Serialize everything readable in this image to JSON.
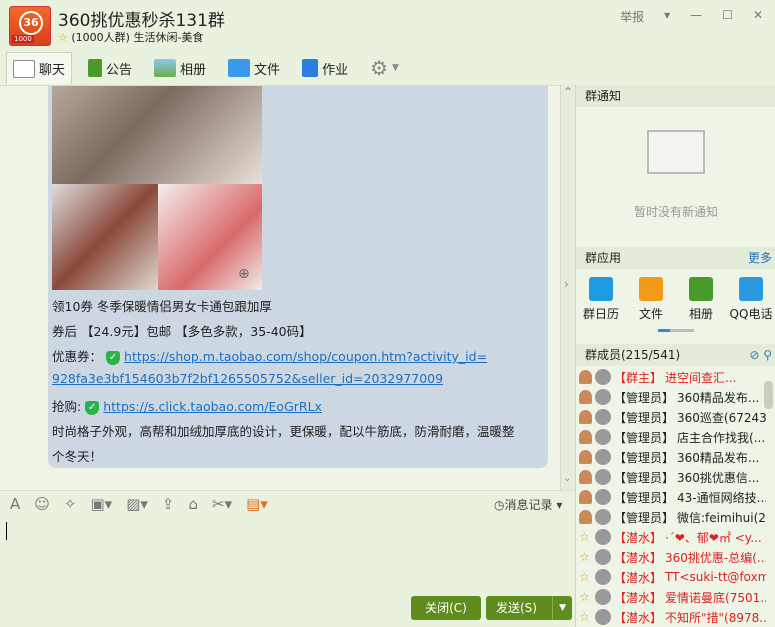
{
  "header": {
    "title": "360挑优惠秒杀131群",
    "subtitle": "(1000人群) 生活休闲-美食",
    "logo_text": "36",
    "logo_badge": "1000",
    "report": "举报",
    "controls": [
      "▾",
      "—",
      "☐",
      "✕"
    ]
  },
  "tabs": [
    {
      "label": "聊天",
      "icon": "chat-icon"
    },
    {
      "label": "公告",
      "icon": "announcement-icon"
    },
    {
      "label": "相册",
      "icon": "album-icon"
    },
    {
      "label": "文件",
      "icon": "folder-icon"
    },
    {
      "label": "作业",
      "icon": "homework-icon"
    }
  ],
  "message": {
    "lines": [
      "领10券 冬季保暖情侣男女卡通包跟加厚",
      "券后 【24.9元】包邮 【多色多款，35-40码】"
    ],
    "coupon_label": "优惠券：",
    "coupon_link_1": "https://shop.m.taobao.com/shop/coupon.htm?activity_id=",
    "coupon_link_2": "928fa3e3bf154603b7f2bf1265505752&seller_id=2032977009",
    "buy_label": "抢购:",
    "buy_link": "https://s.click.taobao.com/EoGrRLx",
    "desc_1": "时尚格子外观，高帮和加绒加厚底的设计，更保暖，配以牛筋底，防滑耐磨，温暖整",
    "desc_2": "个冬天！"
  },
  "notice": {
    "title": "群通知",
    "empty": "暂时没有新通知"
  },
  "apps": {
    "title": "群应用",
    "more": "更多",
    "items": [
      {
        "label": "群日历",
        "color": "#1e9be0"
      },
      {
        "label": "文件",
        "color": "#f29a1a"
      },
      {
        "label": "相册",
        "color": "#4a9a2a"
      },
      {
        "label": "QQ电话",
        "color": "#2a9ae0"
      }
    ]
  },
  "members": {
    "title": "群成员(215/541)",
    "items": [
      {
        "role": "【群主】",
        "name": "进空间查汇...",
        "red": true
      },
      {
        "role": "【管理员】",
        "name": "360精品发布...",
        "red": false
      },
      {
        "role": "【管理员】",
        "name": "360巡查(67243...",
        "red": false
      },
      {
        "role": "【管理员】",
        "name": "店主合作找我(...",
        "red": false
      },
      {
        "role": "【管理员】",
        "name": "360精品发布...",
        "red": false
      },
      {
        "role": "【管理员】",
        "name": "360挑优惠信...",
        "red": false
      },
      {
        "role": "【管理员】",
        "name": "43-通恒网络技...",
        "red": false
      },
      {
        "role": "【管理员】",
        "name": "微信:feimihui(2...",
        "red": false
      },
      {
        "role": "【潜水】",
        "name": "·´❤、郁❤㎡ <y...",
        "red": true
      },
      {
        "role": "【潜水】",
        "name": "360挑优惠-总编(...",
        "red": true
      },
      {
        "role": "【潜水】",
        "name": "TT<suki-tt@foxm...",
        "red": true
      },
      {
        "role": "【潜水】",
        "name": "爱情诺曼底(7501...",
        "red": true
      },
      {
        "role": "【潜水】",
        "name": "不知所\"措\"(8978...",
        "red": true
      }
    ]
  },
  "input": {
    "history": "消息记录",
    "close": "关闭(C)",
    "send": "发送(S)"
  }
}
